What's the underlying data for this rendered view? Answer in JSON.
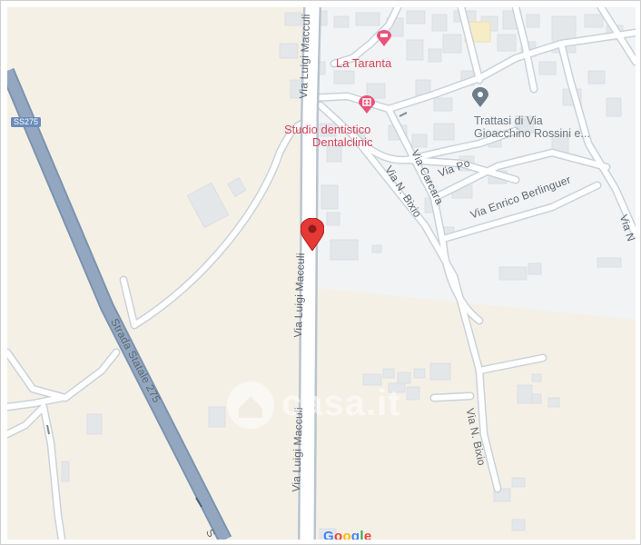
{
  "map": {
    "roads": {
      "strada_statale": "Strada Statale 275",
      "ss275_shield": "SS275",
      "via_luigi_macculi": "Via Luigi Macculi",
      "via_n_bixio": "Via N. Bixio",
      "via_carcara": "Via Carcara",
      "via_po": "Via Po",
      "via_enrico_berlinguer": "Via Enrico Berlinguer",
      "via_n_edge": "Via N",
      "strada_edge": "S"
    },
    "pois": {
      "la_taranta": "La Taranta",
      "dentist_line1": "Studio dentistico",
      "dentist_line2": "Dentalclinic",
      "trattasi_line1": "Trattasi di Via",
      "trattasi_line2": "Gioacchino Rossini e..."
    },
    "watermark": "casa.it",
    "google_logo": "Google",
    "colors": {
      "land": "#f5f0e6",
      "urban": "#f1f3f4",
      "road": "#ffffff",
      "road_casing": "#c6d0d8",
      "highway": "#8ea3bb",
      "pin": "#e53935",
      "poi_pink": "#e8537a",
      "poi_grey": "#6f7880"
    },
    "icons": [
      "hotel-icon",
      "dentist-icon",
      "location-pin-icon",
      "grey-place-pin-icon",
      "casa-house-icon"
    ]
  }
}
